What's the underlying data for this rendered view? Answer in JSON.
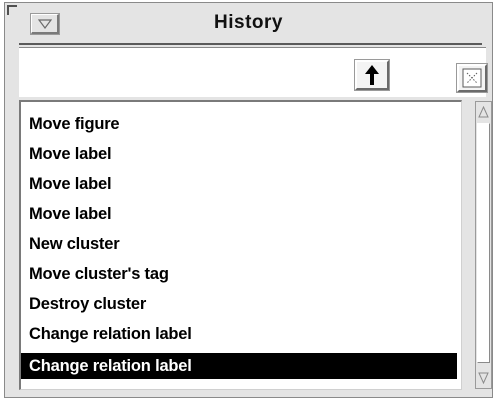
{
  "window": {
    "title": "History"
  },
  "toolbar": {
    "up_button_icon": "up-arrow-icon",
    "close_button_icon": "close-box-icon",
    "menu_button_icon": "menu-triangle-icon"
  },
  "history": {
    "items": [
      {
        "label": "Move figure",
        "selected": false
      },
      {
        "label": "Move label",
        "selected": false
      },
      {
        "label": "Move label",
        "selected": false
      },
      {
        "label": "Move label",
        "selected": false
      },
      {
        "label": "New cluster",
        "selected": false
      },
      {
        "label": "Move cluster's tag",
        "selected": false
      },
      {
        "label": "Destroy cluster",
        "selected": false
      },
      {
        "label": "Change relation label",
        "selected": false
      },
      {
        "label": "Change relation label",
        "selected": true
      }
    ]
  },
  "colors": {
    "window_bg": "#e4e4e4",
    "list_bg": "#ffffff",
    "selection_bg": "#000000",
    "selection_fg": "#ffffff",
    "text": "#000000"
  }
}
